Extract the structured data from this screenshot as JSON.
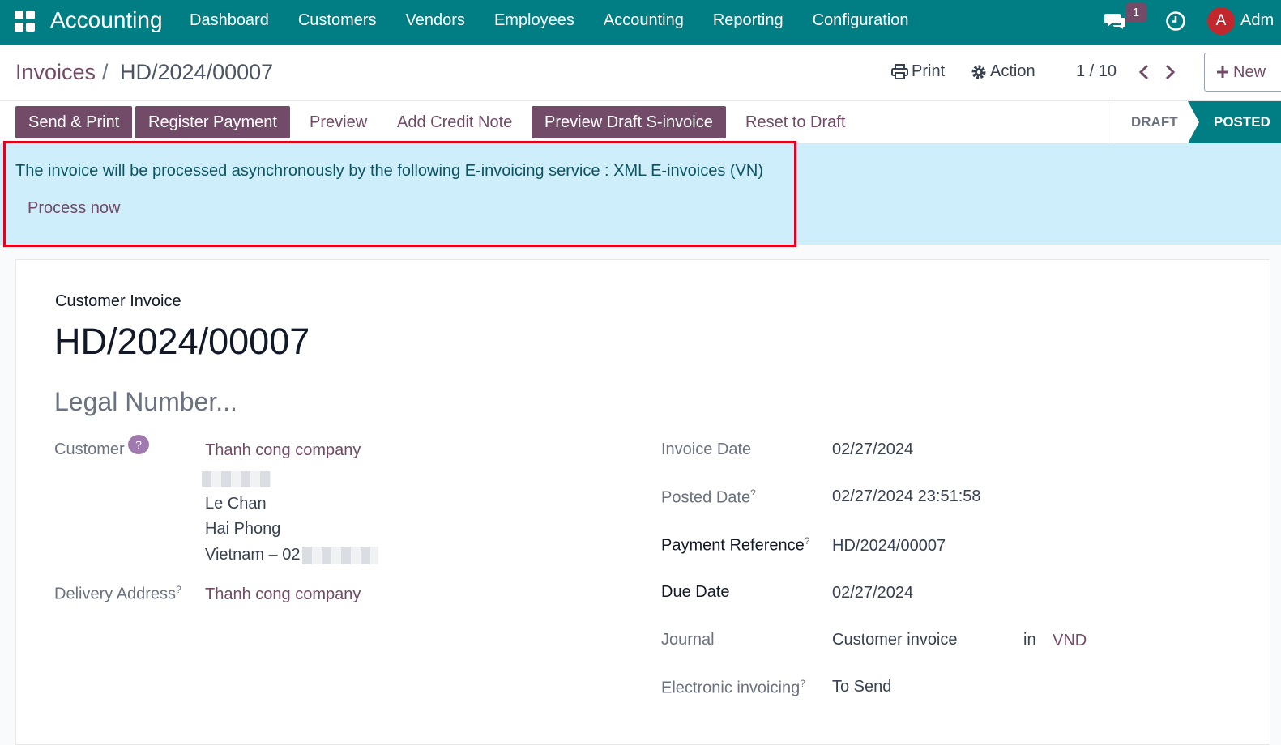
{
  "topbar": {
    "app_name": "Accounting",
    "nav": [
      "Dashboard",
      "Customers",
      "Vendors",
      "Employees",
      "Accounting",
      "Reporting",
      "Configuration"
    ],
    "chat_badge": "1",
    "user_initial": "A",
    "user_name": "Adm"
  },
  "control": {
    "breadcrumb_parent": "Invoices",
    "breadcrumb_sep": "/",
    "breadcrumb_current": "HD/2024/00007",
    "print_label": "Print",
    "action_label": "Action",
    "pager": "1 / 10",
    "new_label": "New"
  },
  "buttons": {
    "send_print": "Send & Print",
    "register_payment": "Register Payment",
    "preview": "Preview",
    "add_credit_note": "Add Credit Note",
    "preview_draft": "Preview Draft S-invoice",
    "reset_draft": "Reset to Draft"
  },
  "status": {
    "draft": "DRAFT",
    "posted": "POSTED"
  },
  "alert": {
    "message": "The invoice will be processed asynchronously by the following E-invoicing service : XML E-invoices (VN)",
    "action": "Process now"
  },
  "form": {
    "doc_type": "Customer Invoice",
    "name": "HD/2024/00007",
    "legal_placeholder": "Legal Number...",
    "customer_label": "Customer",
    "customer_help": "?",
    "customer_name": "Thanh cong company",
    "customer_street": "Le Chan",
    "customer_city": "Hai Phong",
    "customer_country_prefix": "Vietnam – 02",
    "delivery_label": "Delivery Address",
    "delivery_value": "Thanh cong company",
    "help_mark": "?",
    "invoice_date_label": "Invoice Date",
    "invoice_date": "02/27/2024",
    "posted_date_label": "Posted Date",
    "posted_date": "02/27/2024 23:51:58",
    "payment_ref_label": "Payment Reference",
    "payment_ref": "HD/2024/00007",
    "due_date_label": "Due Date",
    "due_date": "02/27/2024",
    "journal_label": "Journal",
    "journal": "Customer invoice",
    "journal_in": "in",
    "currency": "VND",
    "einvoicing_label": "Electronic invoicing",
    "einvoicing": "To Send"
  }
}
